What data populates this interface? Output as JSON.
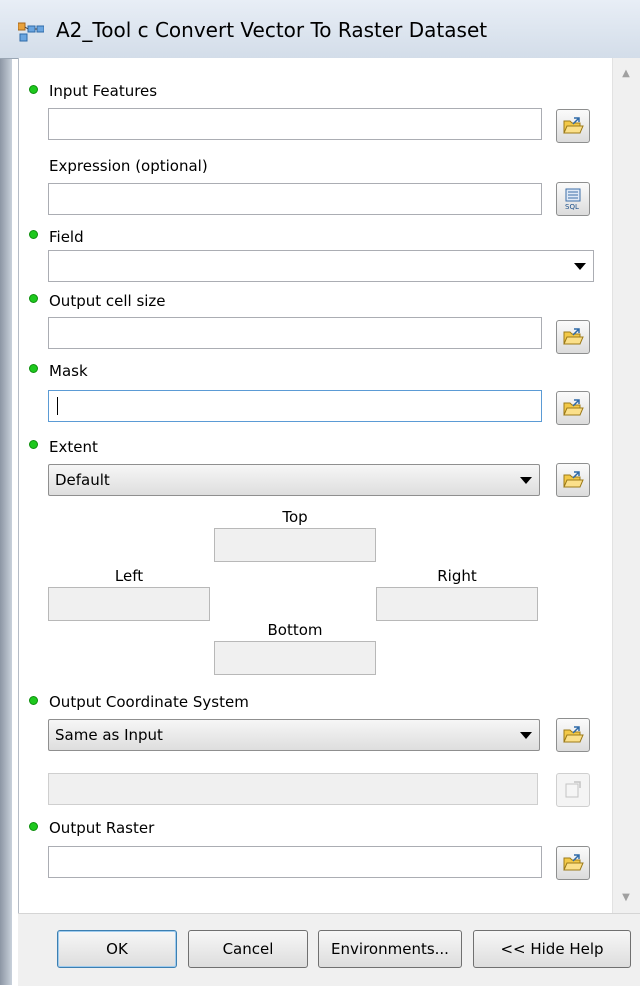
{
  "window": {
    "title": "A2_Tool c Convert Vector To Raster Dataset"
  },
  "fields": {
    "input_features": {
      "label": "Input Features",
      "value": ""
    },
    "expression": {
      "label": "Expression (optional)",
      "value": ""
    },
    "field": {
      "label": "Field",
      "value": ""
    },
    "output_cell_size": {
      "label": "Output cell size",
      "value": ""
    },
    "mask": {
      "label": "Mask",
      "value": ""
    },
    "extent": {
      "label": "Extent",
      "selected": "Default",
      "top_label": "Top",
      "left_label": "Left",
      "right_label": "Right",
      "bottom_label": "Bottom",
      "top": "",
      "left": "",
      "right": "",
      "bottom": ""
    },
    "output_coordinate_system": {
      "label": "Output Coordinate System",
      "selected": "Same as Input",
      "detail": ""
    },
    "output_raster": {
      "label": "Output Raster",
      "value": ""
    }
  },
  "buttons": {
    "ok": "OK",
    "cancel": "Cancel",
    "environments": "Environments...",
    "hide_help": "<< Hide Help"
  },
  "icons": {
    "title": "model-tool-icon",
    "browse": "open-folder-icon",
    "sql": "sql-query-icon",
    "properties": "properties-icon"
  },
  "colors": {
    "required_dot": "#1ec81e",
    "focus_border": "#5b9bd5",
    "default_button_border": "#3c7fb1"
  }
}
